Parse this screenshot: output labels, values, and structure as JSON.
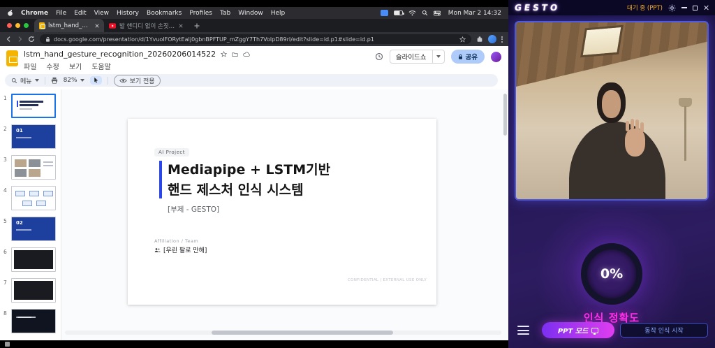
{
  "colors": {
    "accent_blue": "#1a73e8",
    "slide_accent": "#2a46e8",
    "gesto_magenta": "#ff2ee6",
    "status_amber": "#ffb224",
    "share_blue": "#aecbfa"
  },
  "menubar": {
    "items": [
      "Chrome",
      "File",
      "Edit",
      "View",
      "History",
      "Bookmarks",
      "Profiles",
      "Tab",
      "Window",
      "Help"
    ],
    "clock": "Mon Mar 2 14:32"
  },
  "browser": {
    "tabs": [
      {
        "title": "lstm_hand_gesture_recogni"
      },
      {
        "title": "발 핸디디 없이 손짓으로 컴퓨터 제..."
      }
    ],
    "url": "docs.google.com/presentation/d/1YvuoIFORytEaIj0gbnBPFTUP_mZggY7Th7VolpD89rI/edit?slide=id.p1#slide=id.p1"
  },
  "slides": {
    "doc_title": "lstm_hand_gesture_recognition_20260206014522",
    "menus": [
      "파일",
      "수정",
      "보기",
      "도움말"
    ],
    "toolbar": {
      "menu": "메뉴",
      "zoom": "82%",
      "view_only": "보기 전용"
    },
    "slideshow": "슬라이드쇼",
    "share": "공유",
    "thumbs": {
      "numbers": [
        "1",
        "2",
        "3",
        "4",
        "5",
        "6",
        "7",
        "8"
      ],
      "section1": "01",
      "section2": "02"
    },
    "slide": {
      "badge": "AI Project",
      "title1": "Mediapipe + LSTM기반",
      "title2": "핸드 제스처 인식 시스템",
      "subtitle": "[부제 - GESTO]",
      "affiliation": "Affiliation / Team",
      "team": "[우린 팔로 만해]",
      "footer": "CONFIDENTIAL | EXTERNAL USE ONLY"
    }
  },
  "gesto": {
    "title": "GESTO",
    "status": "대기 중 (PPT)",
    "accuracy": "0%",
    "accuracy_label": "인식 정확도",
    "ppt_mode": "PPT 모드",
    "start": "동작 인식 시작"
  }
}
